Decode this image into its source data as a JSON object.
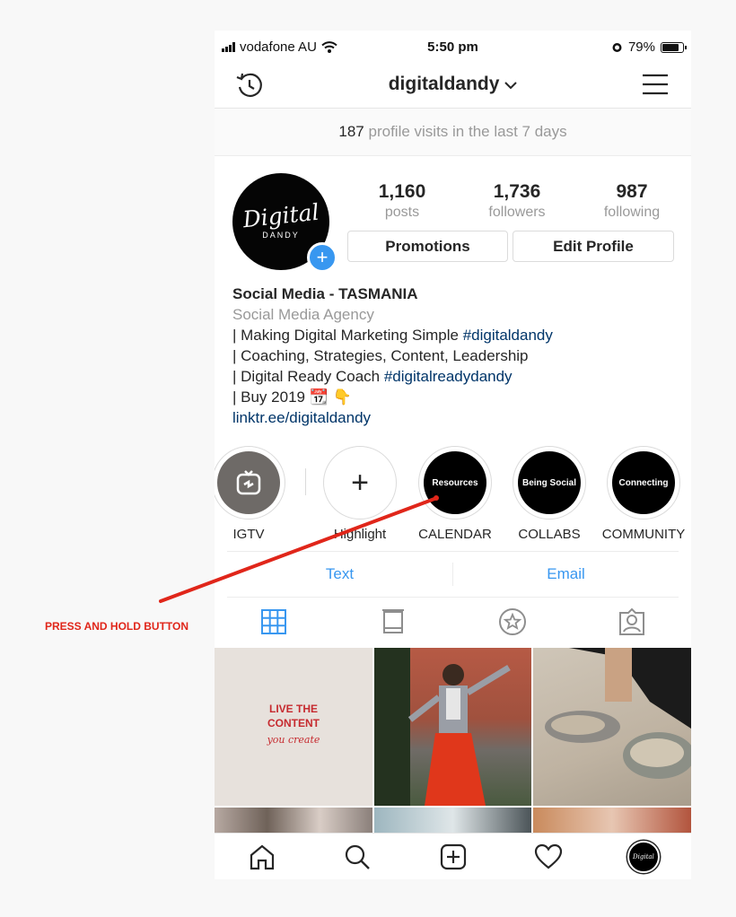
{
  "status_bar": {
    "carrier": "vodafone AU",
    "time": "5:50 pm",
    "battery": "79%"
  },
  "nav": {
    "username": "digitaldandy"
  },
  "insights": {
    "count": "187",
    "text": "profile visits in the last 7 days"
  },
  "avatar": {
    "script_text": "Digital",
    "small_text": "DANDY"
  },
  "stats": [
    {
      "value": "1,160",
      "label": "posts"
    },
    {
      "value": "1,736",
      "label": "followers"
    },
    {
      "value": "987",
      "label": "following"
    }
  ],
  "buttons": {
    "promotions": "Promotions",
    "edit_profile": "Edit Profile"
  },
  "bio": {
    "name": "Social Media - TASMANIA",
    "category": "Social Media Agency",
    "line1_prefix": "| Making Digital Marketing Simple ",
    "line1_tag": "#digitaldandy",
    "line2": "| Coaching, Strategies, Content, Leadership",
    "line3_prefix": "| Digital Ready Coach ",
    "line3_tag": "#digitalreadydandy",
    "line4": "| Buy 2019 📆 👇",
    "link": "linktr.ee/digitaldandy"
  },
  "highlights": [
    {
      "label": "IGTV",
      "cover": ""
    },
    {
      "label": "Highlight",
      "cover": ""
    },
    {
      "label": "CALENDAR",
      "cover": "Resources"
    },
    {
      "label": "COLLABS",
      "cover": "Being Social"
    },
    {
      "label": "COMMUNITY",
      "cover": "Connecting"
    }
  ],
  "contact": {
    "text": "Text",
    "email": "Email"
  },
  "tabs": [
    "grid-icon",
    "igtv-feed-icon",
    "saved-star-icon",
    "tagged-icon"
  ],
  "grid_post": {
    "line1": "LIVE THE",
    "line2": "CONTENT",
    "line3": "you create"
  },
  "bottom_nav": [
    "home-icon",
    "search-icon",
    "add-post-icon",
    "activity-heart-icon",
    "profile-avatar-icon"
  ],
  "annotation": {
    "label": "PRESS AND HOLD BUTTON",
    "color": "#e0261a"
  },
  "colors": {
    "link": "#003569",
    "accent": "#3897f0",
    "muted": "#999999"
  }
}
